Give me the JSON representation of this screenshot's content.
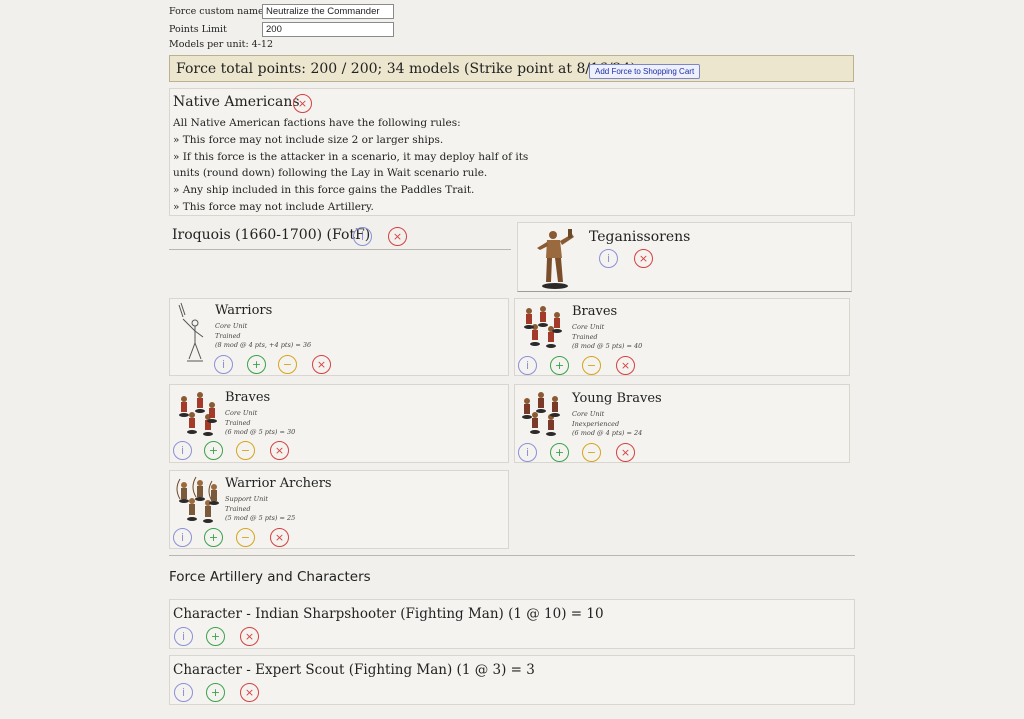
{
  "form": {
    "custom_name_label": "Force custom name:",
    "custom_name_value": "Neutralize the Commander",
    "points_limit_label": "Points Limit",
    "points_limit_value": "200",
    "models_per_unit": "Models per unit: 4-12"
  },
  "banner": {
    "total_text": "Force total points: 200 / 200; 34 models (Strike point at 8/16/24)",
    "cart_button": "Add Force to Shopping Cart"
  },
  "faction": {
    "name": "Native Americans",
    "rules": [
      "All Native American factions have the following rules:",
      "» This force may not include size 2 or larger ships.",
      "» If this force is the attacker in a scenario, it may deploy half of its",
      "units (round down) following the Lay in Wait scenario rule.",
      "» Any ship included in this force gains the Paddles Trait.",
      "» This force may not include Artillery."
    ]
  },
  "subfaction": {
    "name": "Iroquois (1660-1700) (FotF)"
  },
  "commander": {
    "name": "Teganissorens"
  },
  "units": [
    {
      "name": "Warriors",
      "type": "Core Unit",
      "training": "Trained",
      "calc": "(8 mod @ 4 pts, +4 pts) = 36"
    },
    {
      "name": "Braves",
      "type": "Core Unit",
      "training": "Trained",
      "calc": "(8 mod @ 5 pts) = 40"
    },
    {
      "name": "Braves",
      "type": "Core Unit",
      "training": "Trained",
      "calc": "(6 mod @ 5 pts) = 30"
    },
    {
      "name": "Young Braves",
      "type": "Core Unit",
      "training": "Inexperienced",
      "calc": "(6 mod @ 4 pts) = 24"
    },
    {
      "name": "Warrior Archers",
      "type": "Support Unit",
      "training": "Trained",
      "calc": "(5 mod @ 5 pts) = 25"
    }
  ],
  "artillery_section": {
    "title": "Force Artillery and Characters",
    "characters": [
      {
        "label": "Character - Indian Sharpshooter (Fighting Man) (1 @ 10) = 10"
      },
      {
        "label": "Character - Expert Scout (Fighting Man) (1 @ 3) = 3"
      }
    ]
  },
  "icons": {
    "info": "i",
    "plus": "+",
    "minus": "−",
    "remove": "×"
  },
  "colors": {
    "info": "#8a90d8",
    "plus": "#3aa24a",
    "minus": "#d6a41c",
    "remove": "#d64040",
    "banner": "#ece6cf"
  }
}
